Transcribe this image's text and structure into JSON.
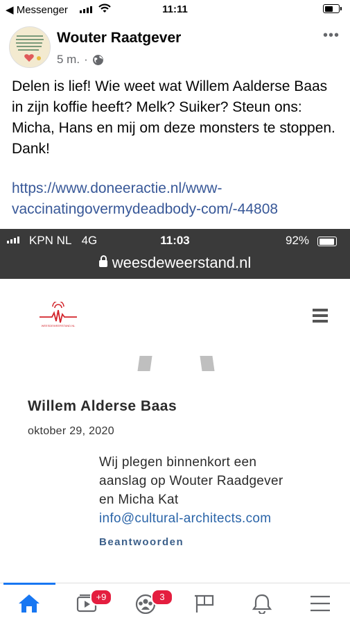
{
  "status_bar": {
    "back_app": "Messenger",
    "time": "11:11",
    "battery_level": 0.6
  },
  "post": {
    "author": "Wouter Raatgever",
    "time_ago": "5 m.",
    "separator": "·",
    "privacy_icon": "globe-icon",
    "more_icon": "more-horizontal-icon",
    "text": "Delen is lief! Wie weet wat Willem Aalderse Baas in zijn koffie heeft? Melk? Suiker? Steun ons: Micha, Hans en mij om deze monsters te stoppen. Dank!",
    "link": "https://www.doneeractie.nl/www-vaccinatingovermydeadbody-com/-44808"
  },
  "embedded_screenshot": {
    "carrier": "KPN NL",
    "network": "4G",
    "time": "11:03",
    "battery_text": "92%",
    "battery_level": 0.92,
    "url": "weesdeweerstand.nl",
    "logo_text": "WEESDEWEERSTAND.NL",
    "comment": {
      "author": "Willem Alderse Baas",
      "date": "oktober 29, 2020",
      "lines": [
        "Wij plegen binnenkort een",
        "aanslag op Wouter Raadgever",
        "en Micha Kat"
      ],
      "email": "info@cultural-architects.com",
      "reply": "Beantwoorden"
    }
  },
  "tab_bar": {
    "tabs": [
      {
        "name": "home",
        "icon": "home-icon",
        "badge": ""
      },
      {
        "name": "watch",
        "icon": "video-icon",
        "badge": "+9"
      },
      {
        "name": "groups",
        "icon": "groups-icon",
        "badge": "3"
      },
      {
        "name": "pages",
        "icon": "flag-icon",
        "badge": ""
      },
      {
        "name": "notifications",
        "icon": "bell-icon",
        "badge": ""
      },
      {
        "name": "menu",
        "icon": "menu-icon",
        "badge": ""
      }
    ]
  },
  "colors": {
    "accent": "#1877f2",
    "link": "#385898",
    "badge": "#e41e3f",
    "logo_red": "#d2232a"
  }
}
